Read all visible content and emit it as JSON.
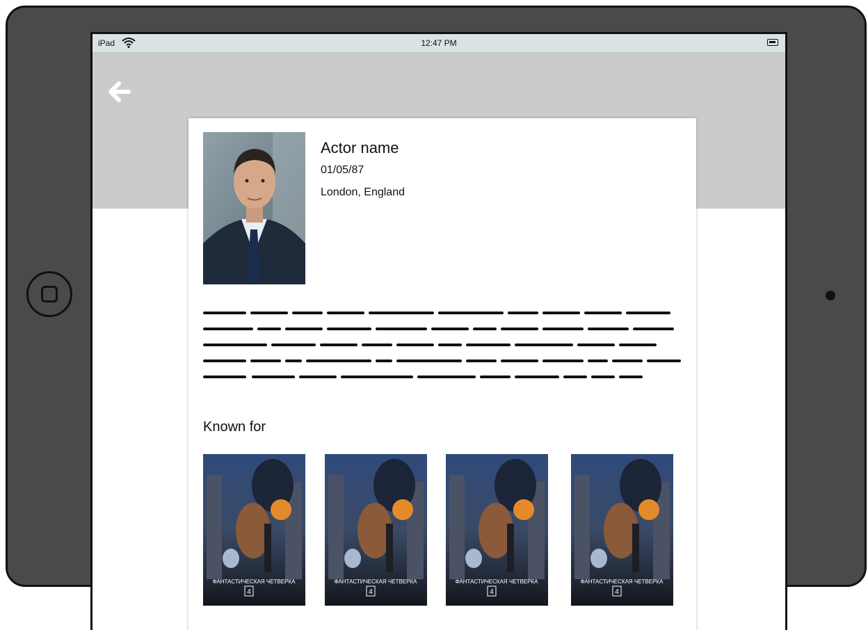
{
  "status_bar": {
    "carrier": "iPad",
    "time": "12:47 PM"
  },
  "header": {
    "back_icon": "back-arrow-icon"
  },
  "actor": {
    "name": "Actor name",
    "dob": "01/05/87",
    "birthplace": "London, England"
  },
  "known_for": {
    "title": "Known for",
    "posters": [
      {
        "caption": "ФАНТАСТИЧЕСКАЯ ЧЕТВЕРКА"
      },
      {
        "caption": "ФАНТАСТИЧЕСКАЯ ЧЕТВЕРКА"
      },
      {
        "caption": "ФАНТАСТИЧЕСКАЯ ЧЕТВЕРКА"
      },
      {
        "caption": "ФАНТАСТИЧЕСКАЯ ЧЕТВЕРКА"
      }
    ]
  },
  "colors": {
    "frame": "#4a4a4a",
    "header_band": "#cbcbcb",
    "status_bar": "#d9e3e3"
  }
}
